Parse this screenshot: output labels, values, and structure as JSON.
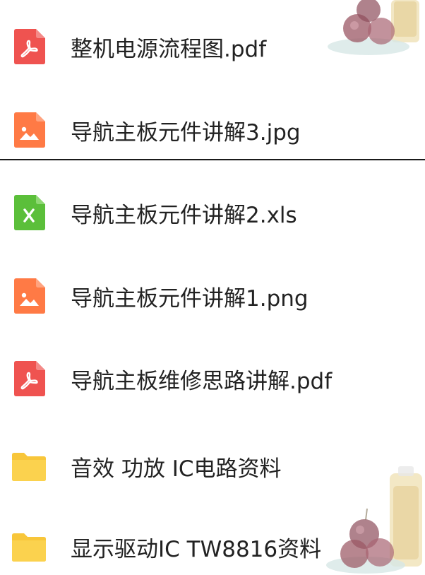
{
  "colors": {
    "pdf": "#ef5350",
    "image": "#ff7a45",
    "excel": "#5bbf3a",
    "folder": "#f8c63a",
    "text": "#222222"
  },
  "files": [
    {
      "name": "整机电源流程图.pdf",
      "type": "pdf",
      "icon": "pdf-file-icon"
    },
    {
      "name": "导航主板元件讲解3.jpg",
      "type": "image",
      "icon": "image-file-icon"
    },
    {
      "name": "导航主板元件讲解2.xls",
      "type": "excel",
      "icon": "excel-file-icon"
    },
    {
      "name": "导航主板元件讲解1.png",
      "type": "image",
      "icon": "image-file-icon"
    },
    {
      "name": "导航主板维修思路讲解.pdf",
      "type": "pdf",
      "icon": "pdf-file-icon"
    },
    {
      "name": "音效 功放 IC电路资料",
      "type": "folder",
      "icon": "folder-icon"
    },
    {
      "name": "显示驱动IC TW8816资料",
      "type": "folder",
      "icon": "folder-icon"
    }
  ]
}
